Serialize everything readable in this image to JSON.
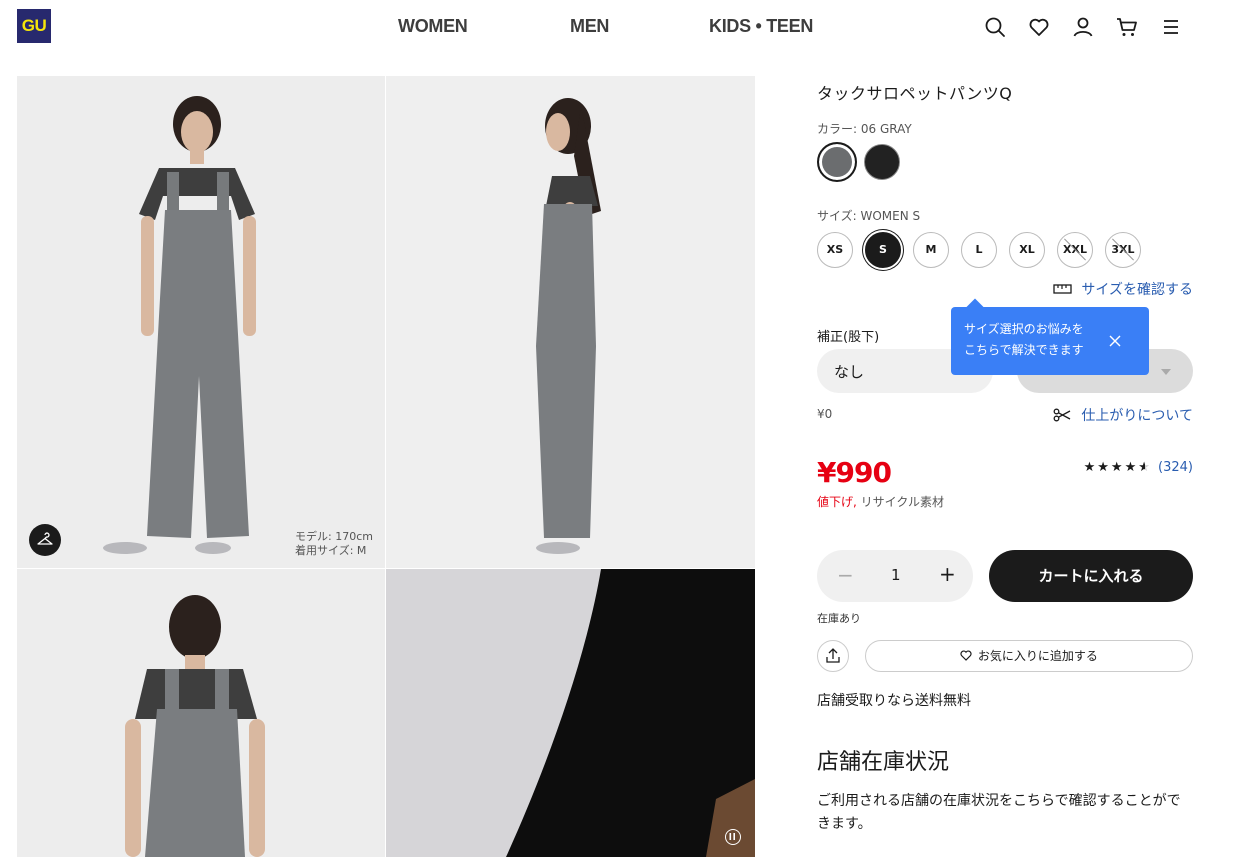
{
  "header": {
    "logo": "GU",
    "nav": [
      "WOMEN",
      "MEN",
      "KIDS • TEEN"
    ]
  },
  "gallery": {
    "model_info_line1": "モデル: 170cm",
    "model_info_line2": "着用サイズ: M"
  },
  "product": {
    "title": "タックサロペットパンツQ",
    "color_label": "カラー: 06 GRAY",
    "colors": [
      "#6b6d6f",
      "#222222"
    ],
    "size_label": "サイズ: WOMEN S",
    "sizes": [
      {
        "label": "XS",
        "state": "available"
      },
      {
        "label": "S",
        "state": "selected"
      },
      {
        "label": "M",
        "state": "available"
      },
      {
        "label": "L",
        "state": "available"
      },
      {
        "label": "XL",
        "state": "available"
      },
      {
        "label": "XXL",
        "state": "unavailable"
      },
      {
        "label": "3XL",
        "state": "unavailable"
      }
    ],
    "size_guide_link": "サイズを確認する",
    "tooltip_line1": "サイズ選択のお悩みを",
    "tooltip_line2": "こちらで解決できます",
    "alteration_label": "補正(股下)",
    "alteration_value": "なし",
    "alteration_price": "¥0",
    "finish_link": "仕上がりについて",
    "price": "¥990",
    "price_tag_1": "値下げ,",
    "price_tag_2": "リサイクル素材",
    "rating_stars": "★★★★★",
    "rating_value": 4.5,
    "review_count": "(324)",
    "quantity": "1",
    "add_to_cart": "カートに入れる",
    "stock_status": "在庫あり",
    "favorite_button": "お気に入りに追加する",
    "shipping_note": "店舗受取りなら送料無料",
    "store_stock_title": "店舗在庫状況",
    "store_stock_body": "ご利用される店舗の在庫状況をこちらで確認することができます。"
  },
  "colors": {
    "brand_navy": "#27296e",
    "brand_yellow": "#f5e50a",
    "price_red": "#e60012",
    "link_blue": "#2a5db0",
    "tooltip_blue": "#3a7ff6"
  }
}
